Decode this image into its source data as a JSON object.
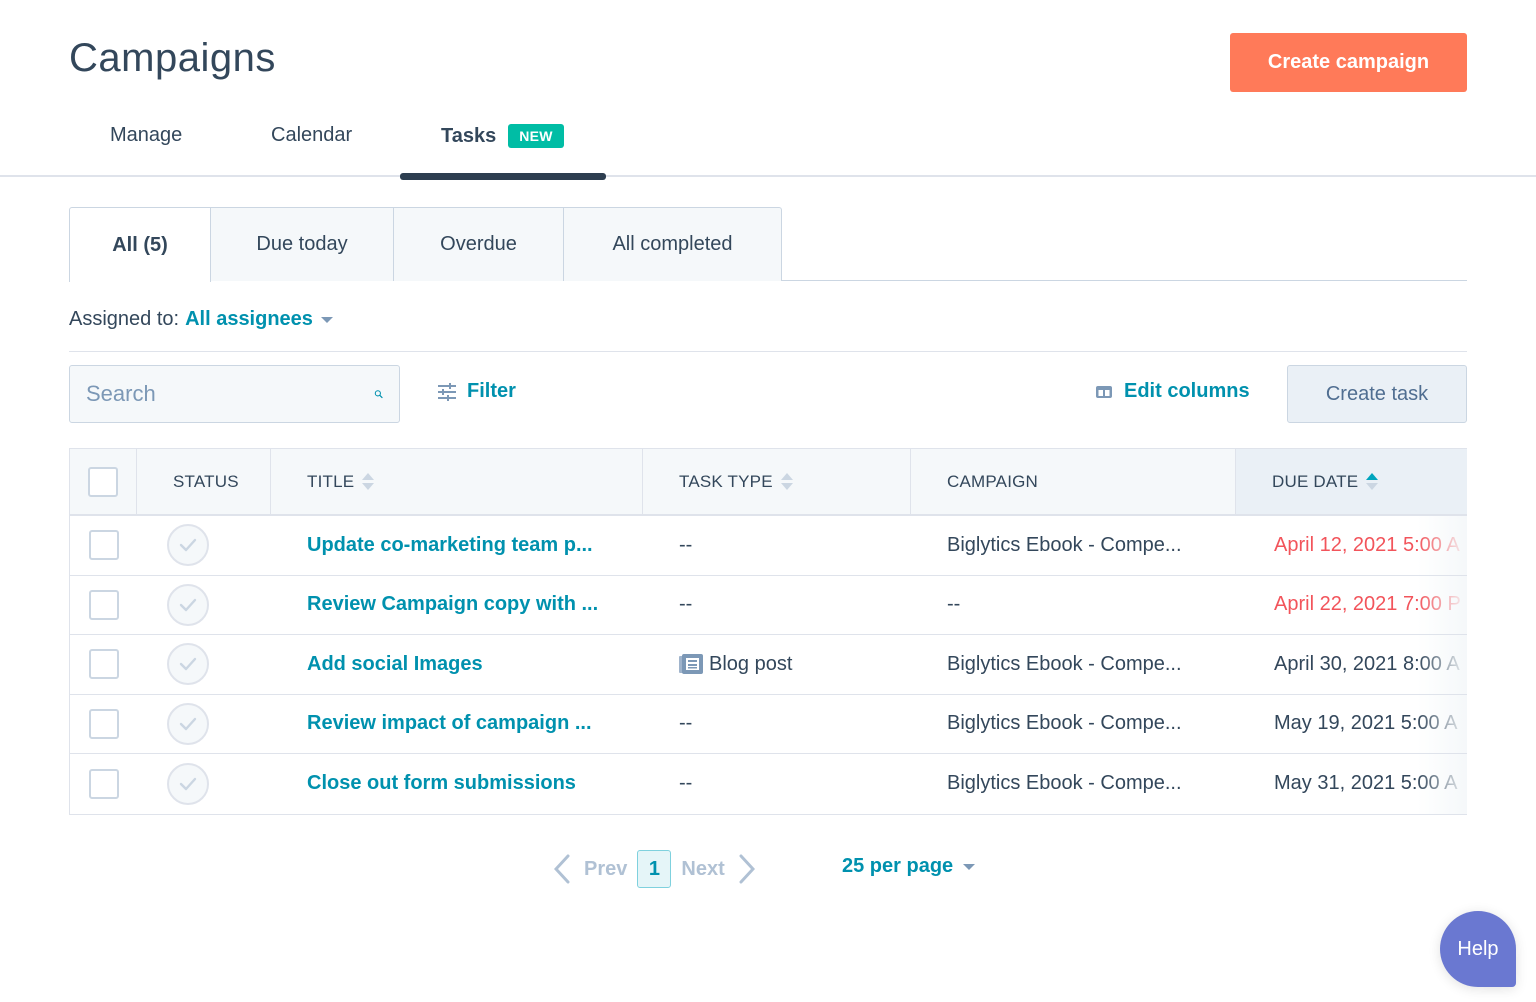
{
  "header": {
    "title": "Campaigns",
    "create_campaign_label": "Create campaign"
  },
  "main_tabs": [
    {
      "label": "Manage",
      "active": false
    },
    {
      "label": "Calendar",
      "active": false
    },
    {
      "label": "Tasks",
      "active": true,
      "badge": "NEW"
    }
  ],
  "sub_tabs": [
    {
      "label": "All (5)",
      "active": true
    },
    {
      "label": "Due today",
      "active": false
    },
    {
      "label": "Overdue",
      "active": false
    },
    {
      "label": "All completed",
      "active": false
    }
  ],
  "assigned": {
    "label": "Assigned to:",
    "value": "All assignees"
  },
  "toolbar": {
    "search_placeholder": "Search",
    "search_value": "",
    "filter_label": "Filter",
    "edit_columns_label": "Edit columns",
    "create_task_label": "Create task"
  },
  "table": {
    "columns": [
      {
        "key": "status",
        "label": "STATUS"
      },
      {
        "key": "title",
        "label": "TITLE",
        "sortable": true
      },
      {
        "key": "task_type",
        "label": "TASK TYPE",
        "sortable": true
      },
      {
        "key": "campaign",
        "label": "CAMPAIGN"
      },
      {
        "key": "due_date",
        "label": "DUE DATE",
        "sortable": true,
        "sort": "ascending"
      }
    ],
    "rows": [
      {
        "title": "Update co-marketing team p...",
        "task_type": "--",
        "campaign": "Biglytics Ebook - Compe...",
        "due_date": "April 12, 2021 5:00 A",
        "overdue": true
      },
      {
        "title": "Review Campaign copy with ...",
        "task_type": "--",
        "campaign": "--",
        "due_date": "April 22, 2021 7:00 P",
        "overdue": true
      },
      {
        "title": "Add social Images",
        "task_type": "Blog post",
        "task_type_icon": "blog-post-icon",
        "campaign": "Biglytics Ebook - Compe...",
        "due_date": "April 30, 2021 8:00 A",
        "overdue": false
      },
      {
        "title": "Review impact of campaign ...",
        "task_type": "--",
        "campaign": "Biglytics Ebook - Compe...",
        "due_date": "May 19, 2021 5:00 A",
        "overdue": false
      },
      {
        "title": "Close out form submissions",
        "task_type": "--",
        "campaign": "Biglytics Ebook - Compe...",
        "due_date": "May 31, 2021 5:00 A",
        "overdue": false
      }
    ]
  },
  "pagination": {
    "prev_label": "Prev",
    "next_label": "Next",
    "current_page": "1",
    "per_page_label": "25 per page"
  },
  "help_label": "Help",
  "colors": {
    "accent_orange": "#ff7a59",
    "link_teal": "#0091ae",
    "badge_green": "#00bda5",
    "overdue_red": "#f2545b",
    "help_purple": "#6a78d1",
    "text_dark": "#33475b"
  }
}
